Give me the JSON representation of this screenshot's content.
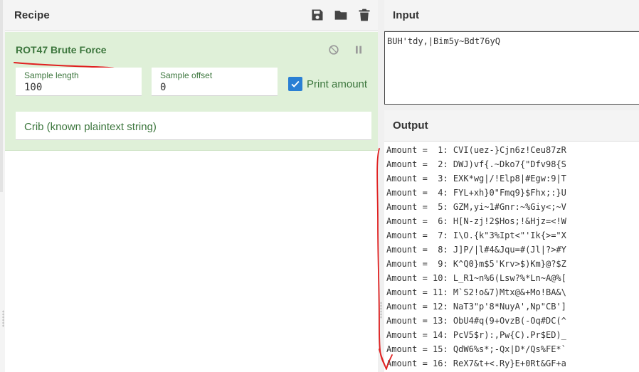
{
  "recipe": {
    "title": "Recipe",
    "actions": [
      {
        "name": "save-icon",
        "label": "save"
      },
      {
        "name": "folder-icon",
        "label": "load"
      },
      {
        "name": "trash-icon",
        "label": "clear"
      }
    ],
    "operation": {
      "title": "ROT47 Brute Force",
      "disable_icon": "ban-icon",
      "pause_icon": "pause-icon",
      "sample_length": {
        "label": "Sample length",
        "value": "100"
      },
      "sample_offset": {
        "label": "Sample offset",
        "value": "0"
      },
      "print_amount": {
        "label": "Print amount",
        "checked": true
      },
      "crib": {
        "placeholder": "Crib (known plaintext string)",
        "value": ""
      }
    }
  },
  "input": {
    "title": "Input",
    "value": "BUH'tdy,|Bim5y~Bdt76yQ"
  },
  "output": {
    "title": "Output",
    "lines": [
      "Amount =  1: CVI(uez-}Cjn6z!Ceu87zR",
      "Amount =  2: DWJ)vf{.~Dko7{\"Dfv98{S",
      "Amount =  3: EXK*wg|/!Elp8|#Egw:9|T",
      "Amount =  4: FYL+xh}0\"Fmq9}$Fhx;:}U",
      "Amount =  5: GZM,yi~1#Gnr:~%Giy<;~V",
      "Amount =  6: H[N-zj!2$Hos;!&Hjz=<!W",
      "Amount =  7: I\\O.{k\"3%Ipt<\"'Ik{>=\"X",
      "Amount =  8: J]P/|l#4&Jqu=#(Jl|?>#Y",
      "Amount =  9: K^Q0}m$5'Krv>$)Km}@?$Z",
      "Amount = 10: L_R1~n%6(Lsw?%*Ln~A@%[",
      "Amount = 11: M`S2!o&7)Mtx@&+Mo!BA&\\",
      "Amount = 12: NaT3\"p'8*NuyA',Np\"CB']",
      "Amount = 13: ObU4#q(9+OvzB(-Oq#DC(^",
      "Amount = 14: PcV5$r):,Pw{C).Pr$ED)_",
      "Amount = 15: QdW6%s*;-Qx|D*/Qs%FE*`",
      "Amount = 16: ReX7&t+<.Ry}E+0Rt&GF+a"
    ]
  },
  "colors": {
    "operation_bg": "#dff0d8",
    "operation_text": "#3c763d",
    "checkbox": "#2a7fd4",
    "annotation": "#e02020"
  }
}
